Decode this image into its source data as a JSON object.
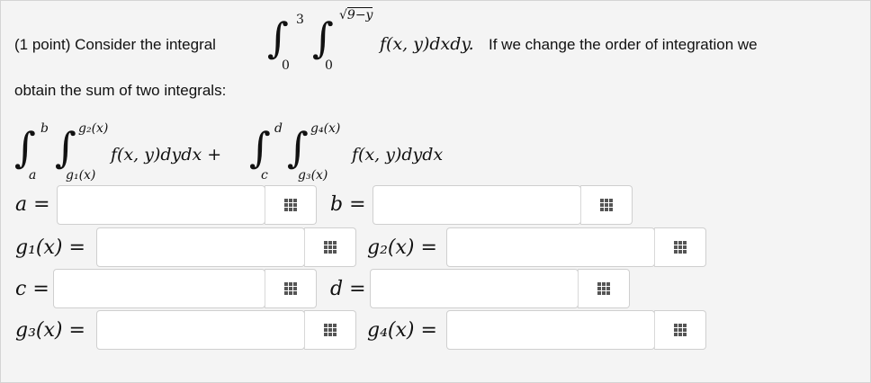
{
  "problem": {
    "points_prefix": "(1 point) Consider the integral",
    "suffix": "If we change the order of integration we",
    "line2": "obtain the sum of two integrals:",
    "integrand": "f(x, y)dxdy.",
    "outer_lower": "0",
    "outer_upper": "3",
    "inner_lower": "0",
    "inner_upper": "9−y"
  },
  "sum_expression": {
    "int1_outer_lower": "a",
    "int1_outer_upper": "b",
    "int1_inner_lower": "g₁(x)",
    "int1_inner_upper": "g₂(x)",
    "int1_integrand": "f(x, y)dydx +",
    "int2_outer_lower": "c",
    "int2_outer_upper": "d",
    "int2_inner_lower": "g₃(x)",
    "int2_inner_upper": "g₄(x)",
    "int2_integrand": "f(x, y)dydx"
  },
  "fields": {
    "a": {
      "label": "a =",
      "value": ""
    },
    "b": {
      "label": "b =",
      "value": ""
    },
    "g1": {
      "label": "g₁(x) =",
      "value": ""
    },
    "g2": {
      "label": "g₂(x) =",
      "value": ""
    },
    "c": {
      "label": "c =",
      "value": ""
    },
    "d": {
      "label": "d =",
      "value": ""
    },
    "g3": {
      "label": "g₃(x) =",
      "value": ""
    },
    "g4": {
      "label": "g₄(x) =",
      "value": ""
    }
  },
  "icons": {
    "math_keyboard": "grid-icon"
  }
}
